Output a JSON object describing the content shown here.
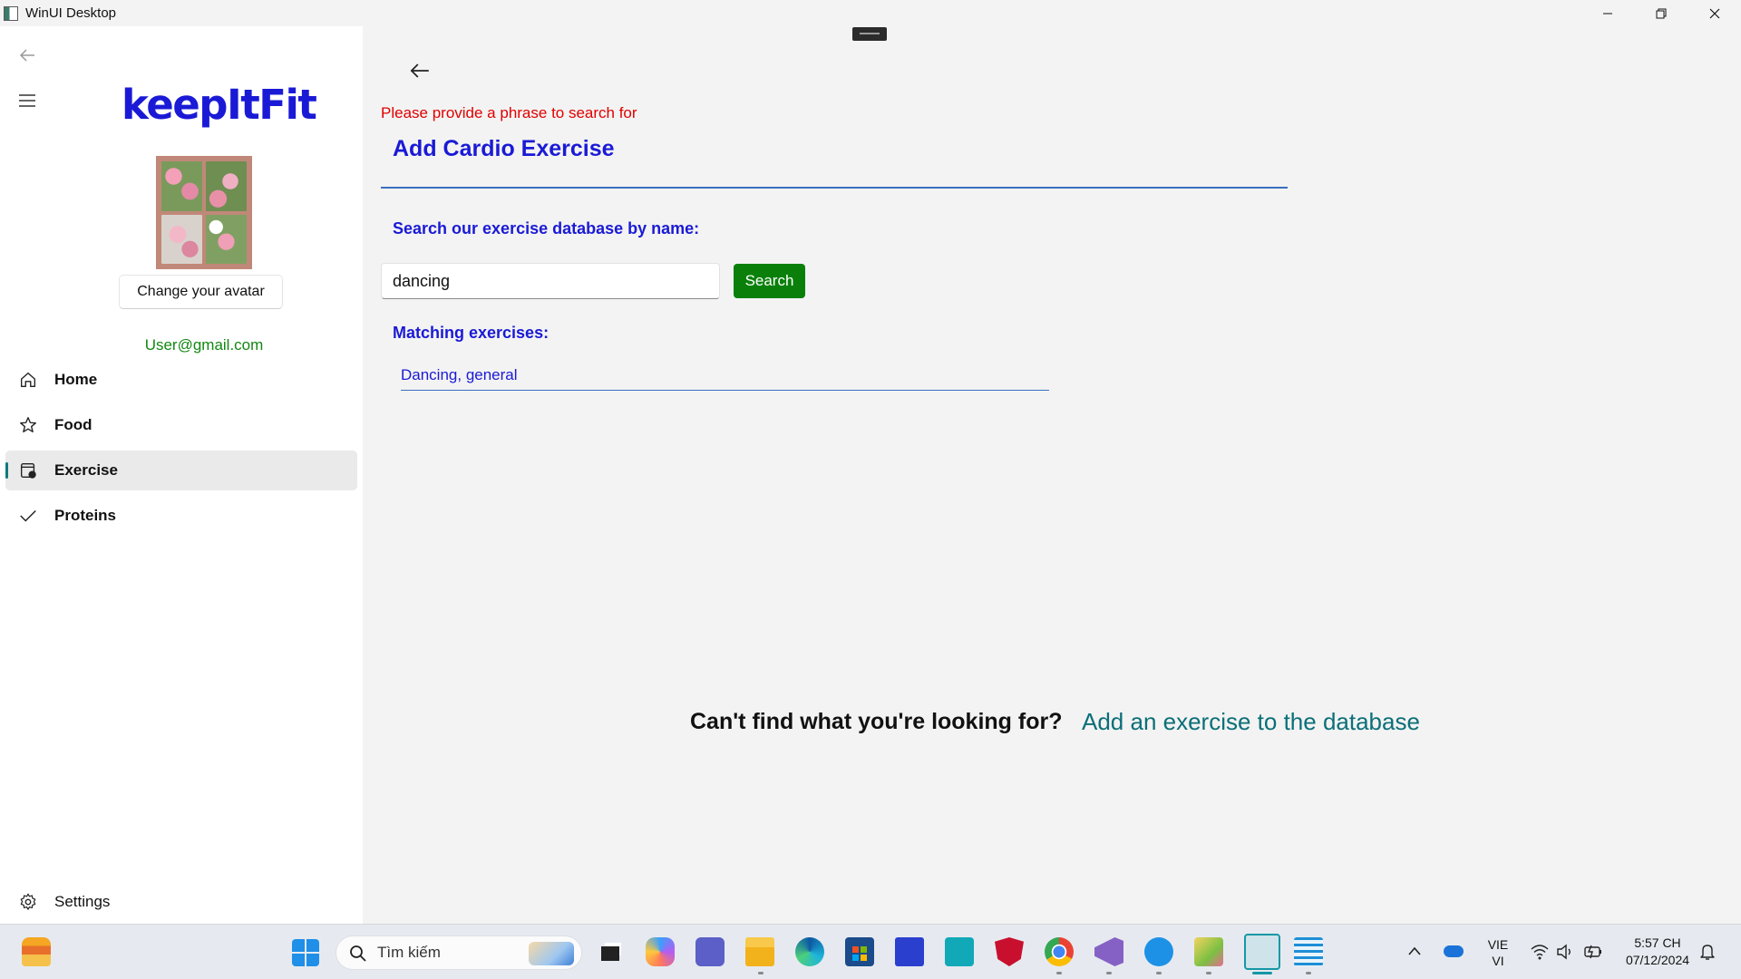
{
  "window": {
    "title": "WinUI Desktop"
  },
  "sidebar": {
    "logo": "keepItFit",
    "avatar_button": "Change your avatar",
    "email": "User@gmail.com",
    "nav": [
      {
        "label": "Home",
        "icon": "home-icon"
      },
      {
        "label": "Food",
        "icon": "star-icon"
      },
      {
        "label": "Exercise",
        "icon": "exercise-icon",
        "selected": true
      },
      {
        "label": "Proteins",
        "icon": "checkmark-icon"
      }
    ],
    "settings_label": "Settings"
  },
  "content": {
    "error_message": "Please provide a phrase to search for",
    "title": "Add Cardio Exercise",
    "search_label": "Search our exercise database by name:",
    "search_value": "dancing",
    "search_button": "Search",
    "matching_label": "Matching exercises:",
    "results": [
      "Dancing, general"
    ],
    "footer_prompt": "Can't find what you're looking for?",
    "footer_link": "Add an exercise to the database"
  },
  "taskbar": {
    "search_placeholder": "Tìm kiếm",
    "language_line1": "VIE",
    "language_line2": "VI",
    "time": "5:57 CH",
    "date": "07/12/2024"
  },
  "colors": {
    "accent_blue": "#1a1ad6",
    "error_red": "#e00000",
    "search_green": "#0a800a",
    "email_green": "#128812",
    "link_teal": "#0b6f78"
  }
}
